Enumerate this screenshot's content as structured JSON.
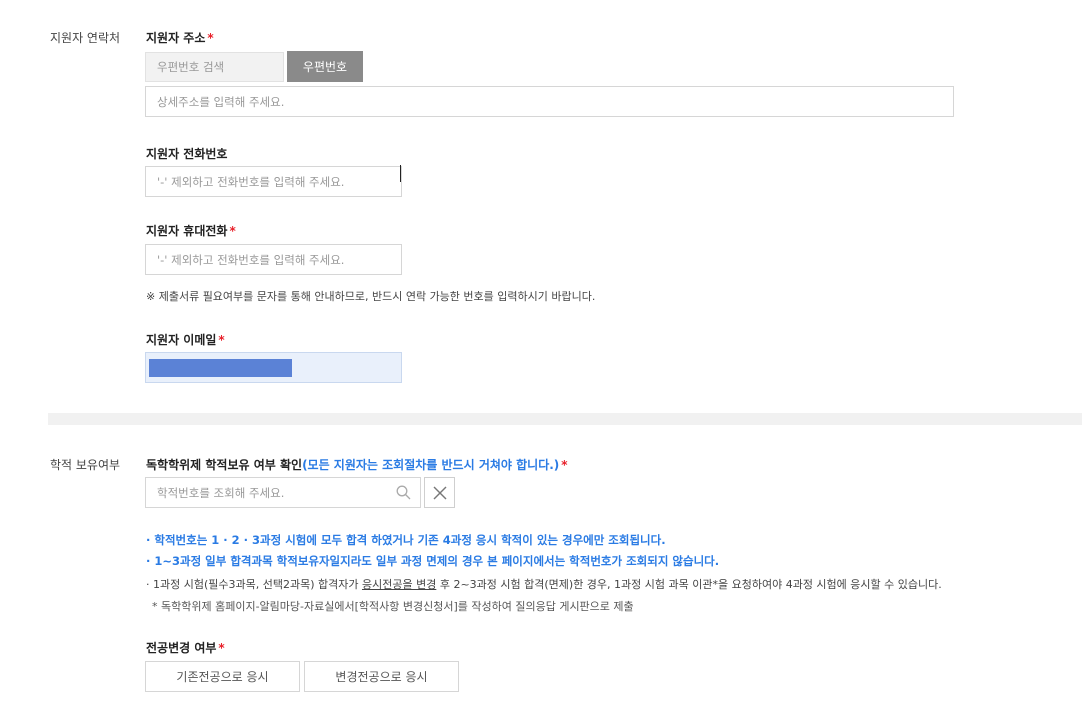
{
  "contact": {
    "side_label": "지원자 연락처",
    "address": {
      "title": "지원자 주소",
      "required_mark": "*",
      "postal_placeholder": "우편번호 검색",
      "postal_button": "우편번호",
      "detail_placeholder": "상세주소를 입력해 주세요."
    },
    "phone": {
      "title": "지원자 전화번호",
      "placeholder": "'-' 제외하고 전화번호를 입력해 주세요."
    },
    "mobile": {
      "title": "지원자 휴대전화",
      "required_mark": "*",
      "placeholder": "'-' 제외하고 전화번호를 입력해 주세요.",
      "notice": "※ 제출서류 필요여부를 문자를 통해 안내하므로, 반드시 연락 가능한 번호를 입력하시기 바랍니다."
    },
    "email": {
      "title": "지원자 이메일",
      "required_mark": "*"
    }
  },
  "academic": {
    "side_label": "학적 보유여부",
    "title_main": "독학학위제 학적보유 여부 확인",
    "title_note": "(모든 지원자는 조회절차를 반드시 거쳐야 합니다.)",
    "required_mark": "*",
    "search_placeholder": "학적번호를 조회해 주세요.",
    "notes": {
      "line1": "· 학적번호는 1 · 2 · 3과정 시험에 모두 합격 하였거나 기존 4과정 응시 학적이 있는 경우에만 조회됩니다.",
      "line2": "· 1~3과정 일부 합격과목 학적보유자일지라도 일부 과정 면제의 경우 본 페이지에서는 학적번호가 조회되지 않습니다.",
      "line3_a": "· 1과정 시험(필수3과목, 선택2과목) 합격자가 ",
      "line3_u": "응시전공을 변경",
      "line3_b": " 후 2~3과정 시험 합격(면제)한 경우, 1과정 시험 과목 이관*을 요청하여야 4과정 시험에 응시할 수 있습니다.",
      "line4": "*   독학학위제 홈페이지-알림마당-자료실에서[학적사항 변경신청서]를 작성하여 질의응답 게시판으로 제출"
    }
  },
  "major_change": {
    "title": "전공변경 여부",
    "required_mark": "*",
    "options": [
      "기존전공으로 응시",
      "변경전공으로 응시"
    ]
  },
  "colors": {
    "accent_blue": "#2a7be4",
    "required_red": "#e8202a",
    "email_fill": "#5b82d6"
  }
}
